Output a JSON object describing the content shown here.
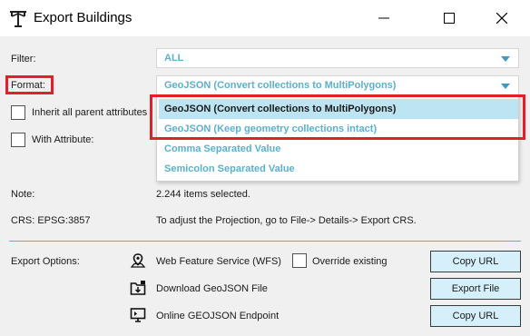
{
  "window": {
    "title": "Export Buildings"
  },
  "form": {
    "filter_label": "Filter:",
    "filter_value": "ALL",
    "format_label": "Format:",
    "format_value": "GeoJSON (Convert collections to MultiPolygons)",
    "inherit_label": "Inherit all parent attributes",
    "with_attribute_label": "With Attribute:",
    "note_label": "Note:",
    "note_value": "2.244 items selected.",
    "crs_label": "CRS: EPSG:3857",
    "crs_value": "To adjust the Projection, go to File-> Details-> Export CRS."
  },
  "dropdown": {
    "options": [
      {
        "label": "GeoJSON (Convert collections to MultiPolygons)",
        "selected": true
      },
      {
        "label": "GeoJSON (Keep geometry collections intact)",
        "selected": false
      },
      {
        "label": "Comma Separated Value",
        "selected": false
      },
      {
        "label": "Semicolon Separated Value",
        "selected": false
      }
    ]
  },
  "export": {
    "options_label": "Export Options:",
    "rows": [
      {
        "icon": "map-pin-icon",
        "label": "Web Feature Service (WFS)",
        "button": "Copy URL"
      },
      {
        "icon": "download-folder-icon",
        "label": "Download GeoJSON File",
        "button": "Export File"
      },
      {
        "icon": "monitor-icon",
        "label": "Online GEOJSON Endpoint",
        "button": "Copy URL"
      }
    ],
    "override_label": "Override existing"
  },
  "colors": {
    "accent": "#5ab0cf",
    "highlight": "#e0202a",
    "button_bg": "#d5f0fb",
    "selected_bg": "#bde4f2"
  }
}
